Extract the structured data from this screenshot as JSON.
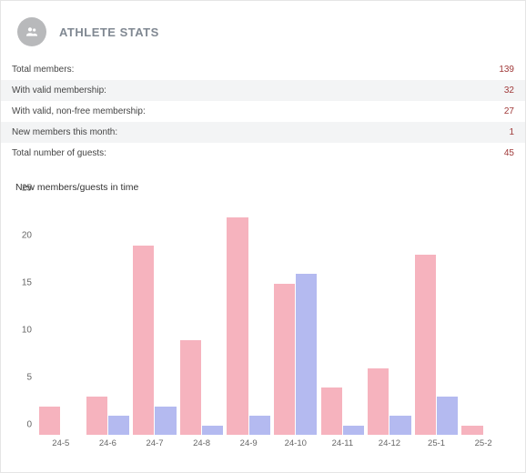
{
  "header": {
    "title": "ATHLETE STATS",
    "icon": "group-icon"
  },
  "stats": [
    {
      "label": "Total members:",
      "value": "139"
    },
    {
      "label": "With valid membership:",
      "value": "32"
    },
    {
      "label": "With valid, non-free membership:",
      "value": "27"
    },
    {
      "label": "New members this month:",
      "value": "1"
    },
    {
      "label": "Total number of guests:",
      "value": "45"
    }
  ],
  "chart_data": {
    "type": "bar",
    "title": "New members/guests in time",
    "xlabel": "",
    "ylabel": "",
    "ylim": [
      0,
      25
    ],
    "yticks": [
      0,
      5,
      10,
      15,
      20,
      25
    ],
    "categories": [
      "24-5",
      "24-6",
      "24-7",
      "24-8",
      "24-9",
      "24-10",
      "24-11",
      "24-12",
      "25-1",
      "25-2"
    ],
    "series": [
      {
        "name": "New members",
        "color": "#f6b3be",
        "values": [
          3,
          4,
          20,
          10,
          23,
          16,
          5,
          7,
          19,
          1
        ]
      },
      {
        "name": "Guests",
        "color": "#b4baf0",
        "values": [
          0,
          2,
          3,
          1,
          2,
          17,
          1,
          2,
          4,
          0
        ]
      }
    ]
  }
}
